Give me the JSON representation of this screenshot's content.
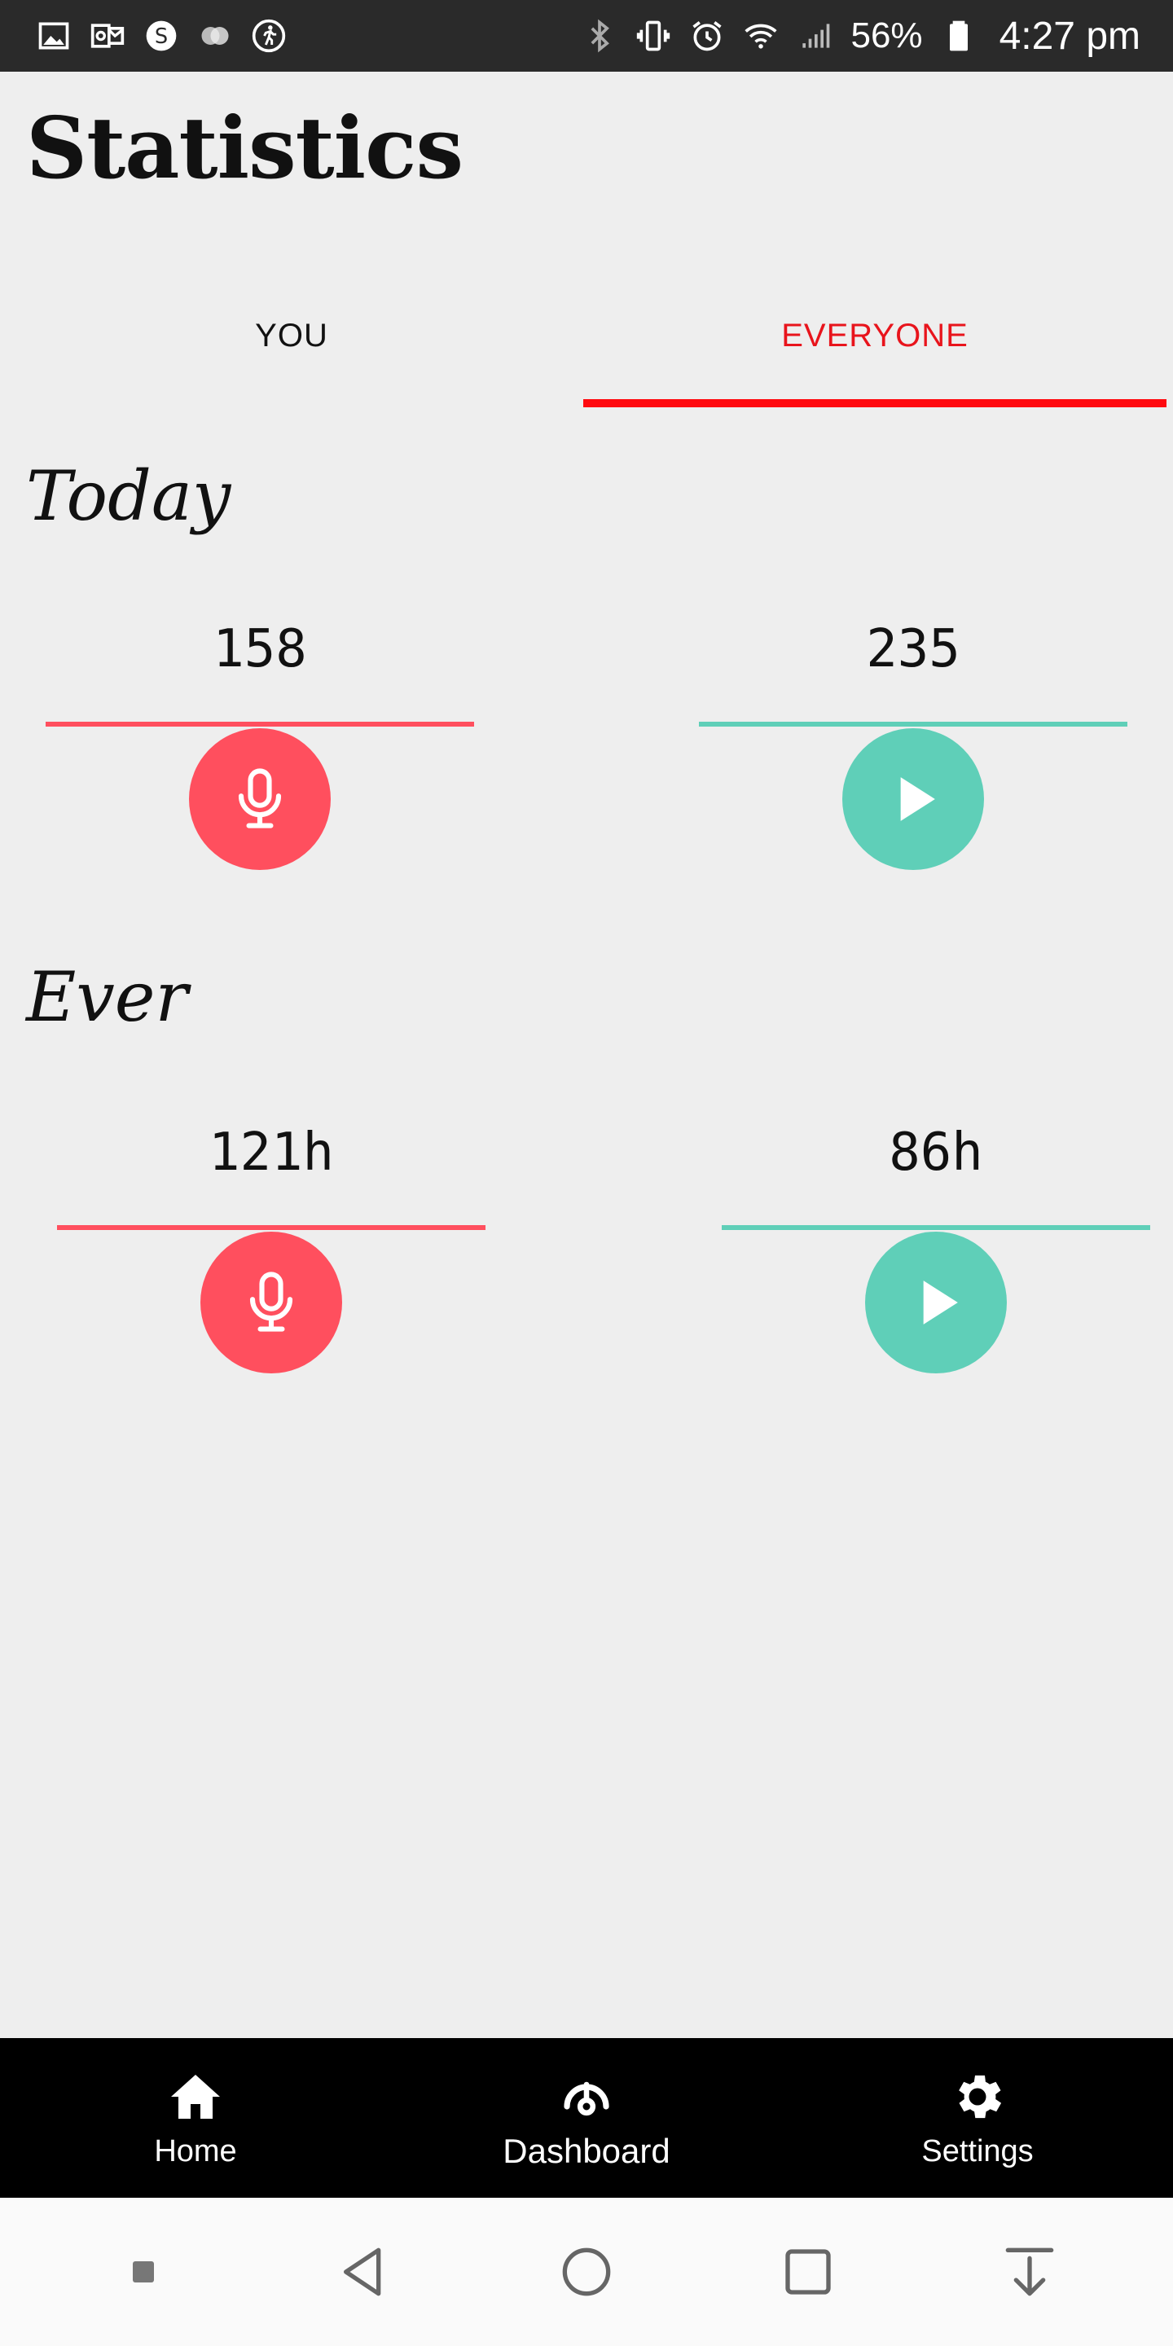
{
  "status_bar": {
    "battery_text": "56%",
    "time": "4:27 pm",
    "left_icons": [
      "image-icon",
      "outlook-icon",
      "s-app-icon",
      "toggle-icon",
      "fitness-icon"
    ],
    "right_icons": [
      "bluetooth-icon",
      "vibrate-icon",
      "alarm-icon",
      "wifi-icon",
      "signal-icon",
      "battery-icon"
    ]
  },
  "header": {
    "title": "Statistics"
  },
  "tabs": [
    {
      "label": "YOU",
      "active": false
    },
    {
      "label": "EVERYONE",
      "active": true
    }
  ],
  "accent_color": "#ff0a0f",
  "sections": {
    "today": {
      "title": "Today",
      "record_value": "158",
      "listen_value": "235"
    },
    "ever": {
      "title": "Ever",
      "record_value": "121h",
      "listen_value": "86h"
    }
  },
  "colors": {
    "record": "#ff4f5e",
    "listen": "#5fcfb8"
  },
  "bottom_nav": [
    {
      "label": "Home",
      "icon": "home-icon"
    },
    {
      "label": "Dashboard",
      "icon": "dashboard-icon"
    },
    {
      "label": "Settings",
      "icon": "gear-icon"
    }
  ],
  "system_nav": [
    "recent-indicator",
    "back-icon",
    "home-circle-icon",
    "overview-icon",
    "download-icon"
  ]
}
